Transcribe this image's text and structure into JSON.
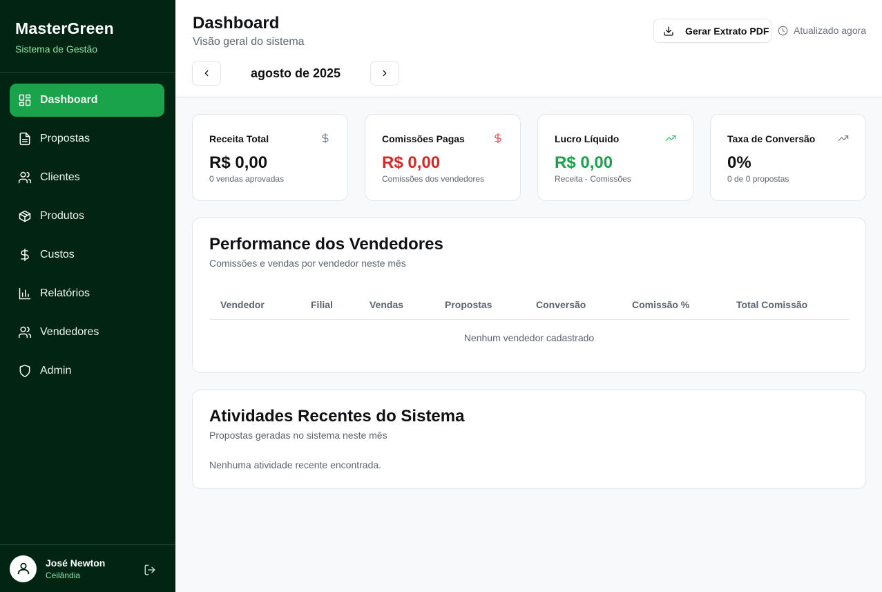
{
  "brand": {
    "title": "MasterGreen",
    "subtitle": "Sistema de Gestão"
  },
  "sidebar": {
    "items": [
      {
        "label": "Dashboard",
        "icon": "layout-dashboard-icon",
        "active": true
      },
      {
        "label": "Propostas",
        "icon": "file-text-icon"
      },
      {
        "label": "Clientes",
        "icon": "users-icon"
      },
      {
        "label": "Produtos",
        "icon": "package-icon"
      },
      {
        "label": "Custos",
        "icon": "dollar-icon"
      },
      {
        "label": "Relatórios",
        "icon": "bar-chart-icon"
      },
      {
        "label": "Vendedores",
        "icon": "users-icon"
      },
      {
        "label": "Admin",
        "icon": "shield-icon"
      }
    ]
  },
  "user": {
    "name": "José Newton",
    "location": "Ceilândia"
  },
  "header": {
    "title": "Dashboard",
    "subtitle": "Visão geral do sistema",
    "month": "agosto de 2025",
    "pdf_button": "Gerar Extrato PDF",
    "updated": "Atualizado agora"
  },
  "stats": [
    {
      "label": "Receita Total",
      "value": "R$ 0,00",
      "note": "0 vendas aprovadas",
      "color": "#111111",
      "icon": "dollar-icon",
      "icon_color": "#6b7a8c"
    },
    {
      "label": "Comissões Pagas",
      "value": "R$ 0,00",
      "note": "Comissões dos vendedores",
      "color": "#dc2626",
      "icon": "dollar-icon",
      "icon_color": "#ef4444"
    },
    {
      "label": "Lucro Líquido",
      "value": "R$ 0,00",
      "note": "Receita - Comissões",
      "color": "#16a34a",
      "icon": "trending-up-icon",
      "icon_color": "#22c55e"
    },
    {
      "label": "Taxa de Conversão",
      "value": "0%",
      "note": "0 de 0 propostas",
      "color": "#111111",
      "icon": "trending-up-icon",
      "icon_color": "#6b7280"
    }
  ],
  "performance": {
    "title": "Performance dos Vendedores",
    "subtitle": "Comissões e vendas por vendedor neste mês",
    "columns": [
      "Vendedor",
      "Filial",
      "Vendas",
      "Propostas",
      "Conversão",
      "Comissão %",
      "Total Comissão"
    ],
    "empty": "Nenhum vendedor cadastrado"
  },
  "activities": {
    "title": "Atividades Recentes do Sistema",
    "subtitle": "Propostas geradas no sistema neste mês",
    "empty": "Nenhuma atividade recente encontrada."
  }
}
